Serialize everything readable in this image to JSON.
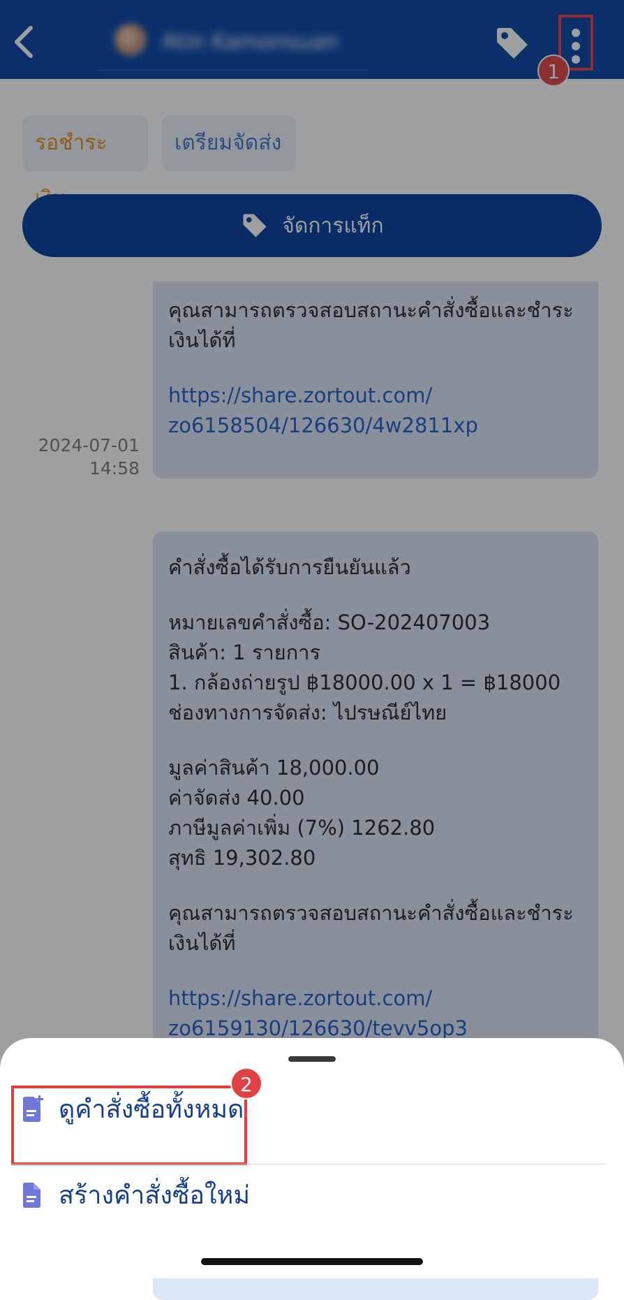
{
  "header": {
    "contact_name": "Atin Kamonsuan",
    "accent_color": "#003fa3"
  },
  "annotations": {
    "badge_1": "1",
    "badge_2": "2"
  },
  "toolbar": {
    "status_chips": [
      "รอชำระเงิน",
      "เตรียมจัดส่ง"
    ],
    "manage_tag_label": "จัดการแท็ก"
  },
  "chat": {
    "message_1": {
      "lines": [
        "คุณสามารถตรวจสอบสถานะคำสั่งซื้อและชำระ",
        "เงินได้ที่"
      ],
      "link_lines": [
        "https://share.zortout.com/",
        "zo6158504/126630/4w2811xp"
      ],
      "timestamp_date": "2024-07-01",
      "timestamp_time": "14:58"
    },
    "message_2": {
      "title": "คำสั่งซื้อได้รับการยืนยันแล้ว",
      "order_lines": [
        "หมายเลขคำสั่งซื้อ: SO-202407003",
        "สินค้า: 1 รายการ",
        "1. กล้องถ่ายรูป ฿18000.00 x 1 = ฿18000",
        "ช่องทางการจัดส่ง: ไปรษณีย์ไทย"
      ],
      "summary_lines": [
        "มูลค่าสินค้า 18,000.00",
        "ค่าจัดส่ง 40.00",
        "ภาษีมูลค่าเพิ่ม (7%) 1262.80",
        "สุทธิ 19,302.80"
      ],
      "footer_lines": [
        "คุณสามารถตรวจสอบสถานะคำสั่งซื้อและชำระ",
        "เงินได้ที่"
      ],
      "link_lines": [
        "https://share.zortout.com/",
        "zo6159130/126630/tevv5op3"
      ]
    }
  },
  "sheet": {
    "items": [
      {
        "label": "ดูคำสั่งซื้อทั้งหมด",
        "icon": "document-add-icon"
      },
      {
        "label": "สร้างคำสั่งซื้อใหม่",
        "icon": "document-icon"
      }
    ]
  }
}
